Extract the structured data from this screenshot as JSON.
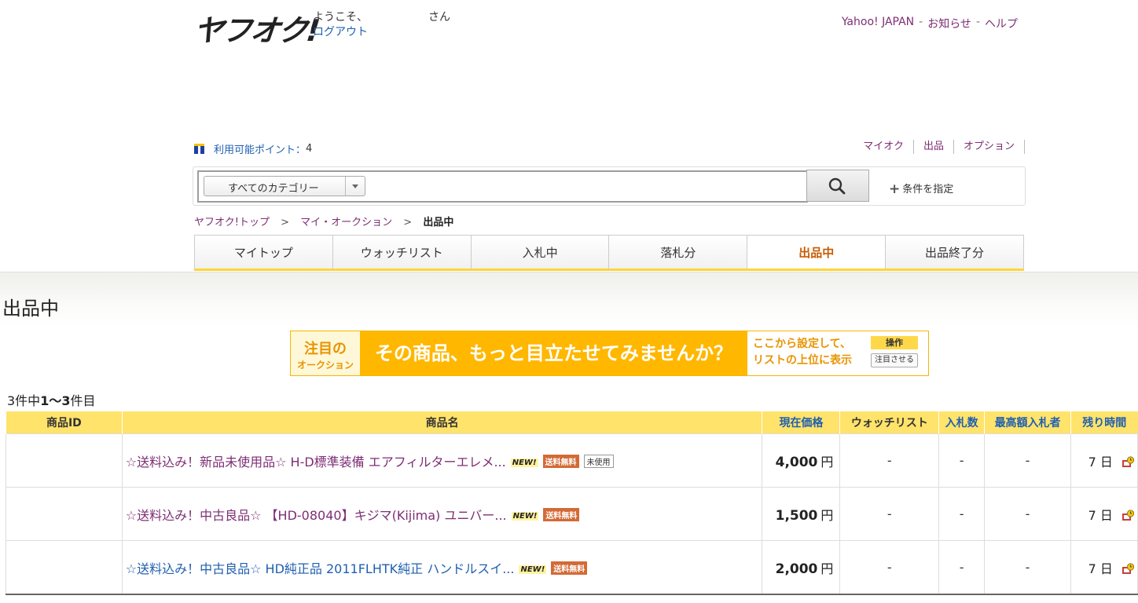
{
  "header": {
    "logo": "ヤフオク!",
    "welcome": "ようこそ、",
    "san": "さん",
    "logout": "ログアウト",
    "links": [
      "Yahoo! JAPAN",
      "お知らせ",
      "ヘルプ"
    ],
    "link_sep": " - "
  },
  "points": {
    "label": "利用可能ポイント：",
    "value": "4"
  },
  "rightnav": [
    "マイオク",
    "出品",
    "オプション"
  ],
  "search": {
    "category": "すべてのカテゴリー",
    "value": "",
    "condition": "条件を指定"
  },
  "breadcrumb": {
    "top": "ヤフオク!トップ",
    "myauction": "マイ・オークション",
    "current": "出品中",
    "sep": ">"
  },
  "tabs": [
    {
      "label": "マイトップ",
      "active": false
    },
    {
      "label": "ウォッチリスト",
      "active": false
    },
    {
      "label": "入札中",
      "active": false
    },
    {
      "label": "落札分",
      "active": false
    },
    {
      "label": "出品中",
      "active": true
    },
    {
      "label": "出品終了分",
      "active": false
    }
  ],
  "page_title": "出品中",
  "banner": {
    "left_a": "注目の",
    "left_b": "オークション",
    "headline": "その商品、もっと目立たせてみませんか？",
    "right_1": "ここから設定して、",
    "right_2": "リストの上位に表示",
    "op_header": "操作",
    "op_button": "注目させる"
  },
  "count": {
    "total": "3件中",
    "range": "1〜3",
    "suffix": "件目"
  },
  "table": {
    "headers": [
      "商品ID",
      "商品名",
      "現在価格",
      "ウォッチリスト",
      "入札数",
      "最高額入札者",
      "残り時間"
    ],
    "rows": [
      {
        "id": "",
        "title": "☆送料込み！新品未使用品☆ H-D標準装備 エアフィルターエレメ...",
        "new": "NEW!",
        "free": "送料無料",
        "unused": "未使用",
        "price": "4,000",
        "yen": "円",
        "watch": "-",
        "bids": "-",
        "top": "-",
        "remaining": "7 日"
      },
      {
        "id": "",
        "title": "☆送料込み！中古良品☆ 【HD-08040】キジマ(Kijima) ユニバー...",
        "new": "NEW!",
        "free": "送料無料",
        "unused": "",
        "price": "1,500",
        "yen": "円",
        "watch": "-",
        "bids": "-",
        "top": "-",
        "remaining": "7 日"
      },
      {
        "id": "",
        "title": "☆送料込み！中古良品☆ HD純正品 2011FLHTK純正 ハンドルスイ...",
        "new": "NEW!",
        "free": "送料無料",
        "unused": "",
        "price": "2,000",
        "yen": "円",
        "watch": "-",
        "bids": "-",
        "top": "-",
        "remaining": "7 日"
      }
    ]
  },
  "colors": {
    "accent_yellow": "#ffe36b",
    "banner_orange": "#ffb700",
    "link_purple": "#7d2e74",
    "link_blue": "#1f5fb0",
    "active_tab": "#c95a00"
  }
}
